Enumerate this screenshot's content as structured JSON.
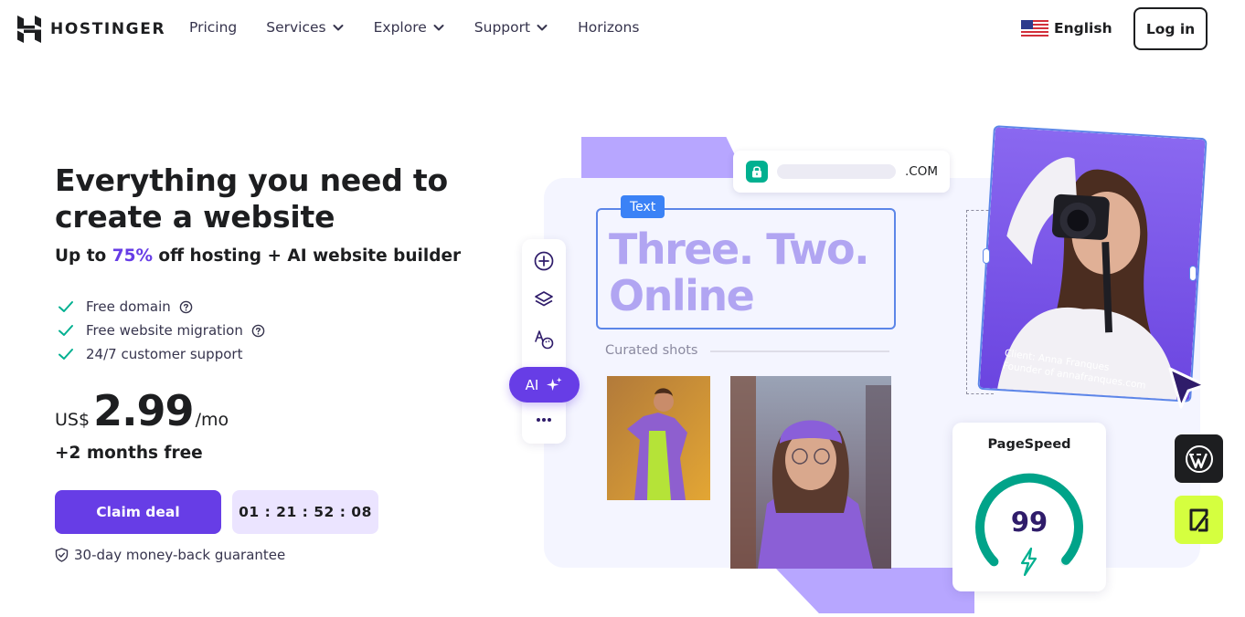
{
  "nav": {
    "logo_text": "HOSTINGER",
    "items": [
      {
        "label": "Pricing",
        "has_dropdown": false
      },
      {
        "label": "Services",
        "has_dropdown": true
      },
      {
        "label": "Explore",
        "has_dropdown": true
      },
      {
        "label": "Support",
        "has_dropdown": true
      },
      {
        "label": "Horizons",
        "has_dropdown": false
      }
    ],
    "language": "English",
    "login_label": "Log in"
  },
  "hero": {
    "headline": "Everything you need to create a website",
    "subhead_prefix": "Up to ",
    "subhead_percent": "75%",
    "subhead_suffix": " off hosting + AI website builder",
    "features": [
      {
        "label": "Free domain",
        "has_help": true
      },
      {
        "label": "Free website migration",
        "has_help": true
      },
      {
        "label": "24/7 customer support",
        "has_help": false
      }
    ],
    "price": {
      "currency": "US$",
      "amount": "2.99",
      "period": "/mo"
    },
    "bonus": "+2 months free",
    "cta_label": "Claim deal",
    "countdown": "01 : 21 : 52 : 08",
    "guarantee": "30-day money-back guarantee"
  },
  "illustration": {
    "url_tld": ".COM",
    "text_tag": "Text",
    "big_text": "Three. Two. Online",
    "ai_label": "AI",
    "curated_label": "Curated shots",
    "client_line1": "Client: Anna Franques",
    "client_line2": "Founder of annafranques.com",
    "pagespeed_title": "PageSpeed",
    "pagespeed_score": "99",
    "pagespeed_fraction": 0.99
  },
  "colors": {
    "brand_purple": "#673de6",
    "accent_light_purple": "#b7a6ff",
    "teal": "#00b090",
    "lime": "#d5ff3f"
  }
}
